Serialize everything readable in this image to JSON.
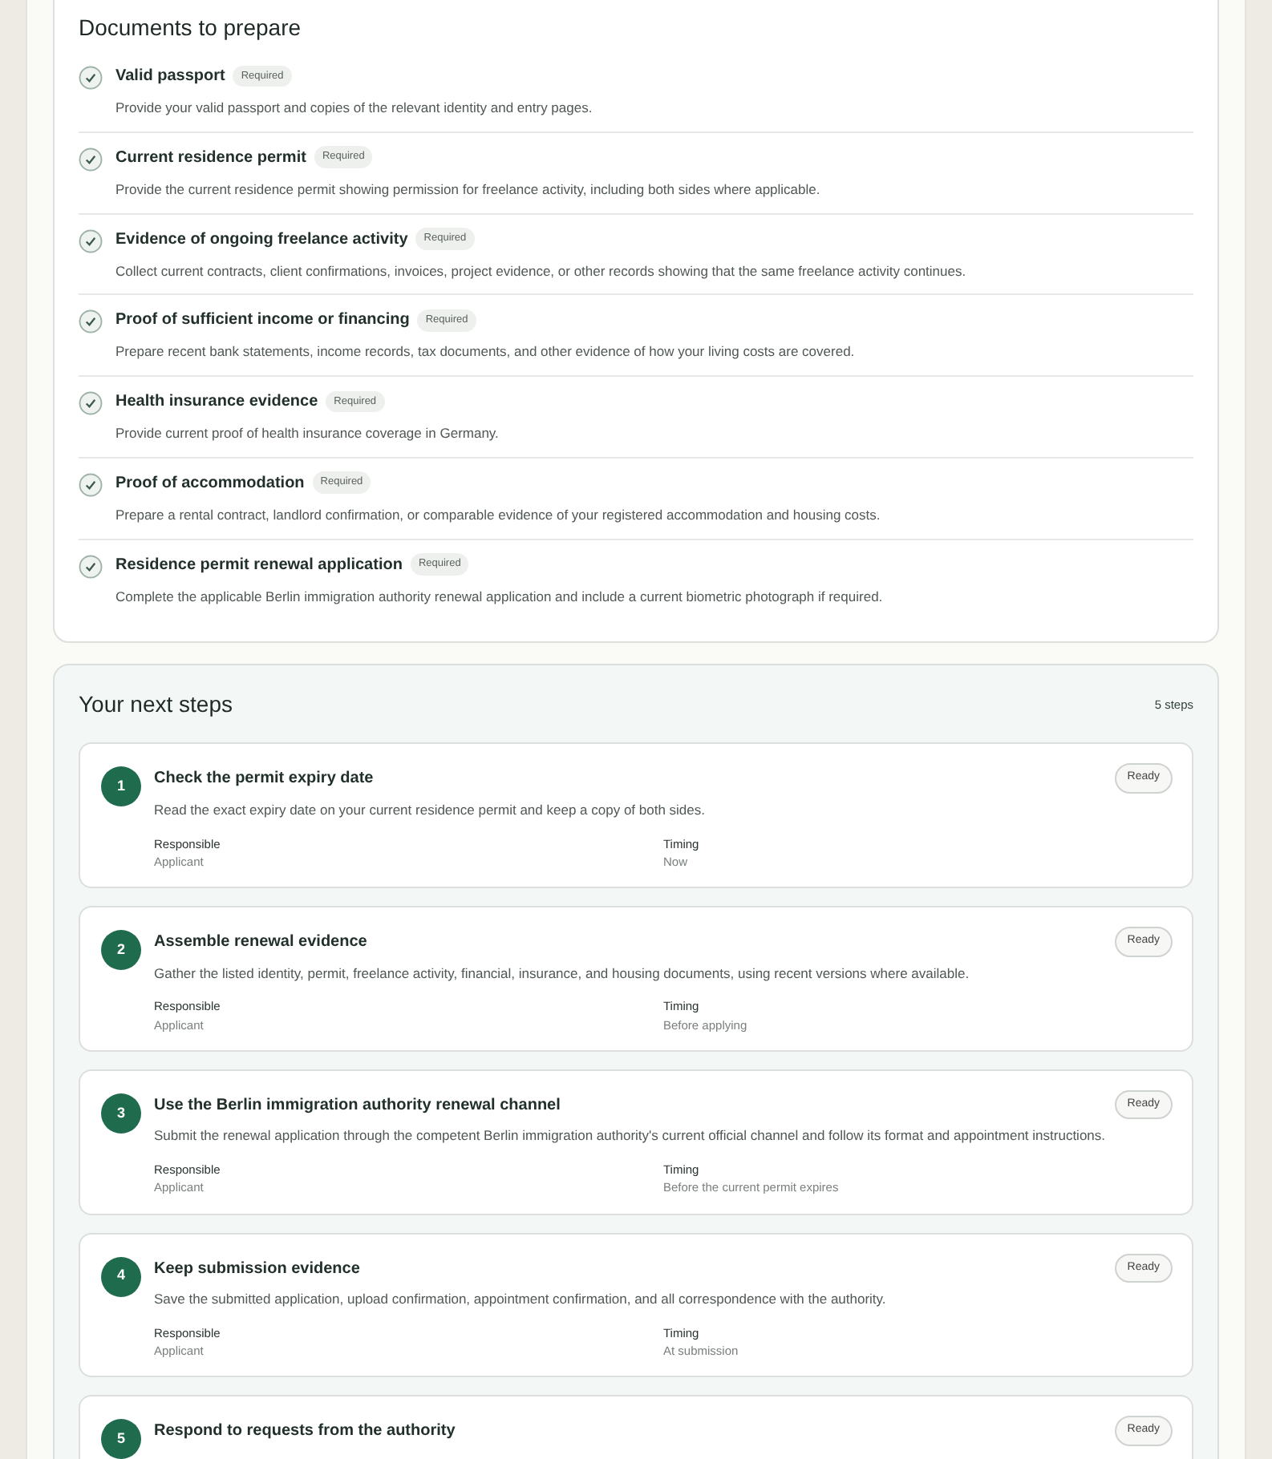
{
  "documents": {
    "title": "Documents to prepare",
    "items": [
      {
        "name": "Valid passport",
        "badge": "Required",
        "checked": true,
        "description": "Provide your valid passport and copies of the relevant identity and entry pages."
      },
      {
        "name": "Current residence permit",
        "badge": "Required",
        "checked": true,
        "description": "Provide the current residence permit showing permission for freelance activity, including both sides where applicable."
      },
      {
        "name": "Evidence of ongoing freelance activity",
        "badge": "Required",
        "checked": true,
        "description": "Collect current contracts, client confirmations, invoices, project evidence, or other records showing that the same freelance activity continues."
      },
      {
        "name": "Proof of sufficient income or financing",
        "badge": "Required",
        "checked": true,
        "description": "Prepare recent bank statements, income records, tax documents, and other evidence of how your living costs are covered."
      },
      {
        "name": "Health insurance evidence",
        "badge": "Required",
        "checked": true,
        "description": "Provide current proof of health insurance coverage in Germany."
      },
      {
        "name": "Proof of accommodation",
        "badge": "Required",
        "checked": true,
        "description": "Prepare a rental contract, landlord confirmation, or comparable evidence of your registered accommodation and housing costs."
      },
      {
        "name": "Residence permit renewal application",
        "badge": "Required",
        "checked": true,
        "description": "Complete the applicable Berlin immigration authority renewal application and include a current biometric photograph if required."
      }
    ]
  },
  "next_steps": {
    "title": "Your next steps",
    "count": "5 steps",
    "steps": [
      {
        "number": "1",
        "title": "Check the permit expiry date",
        "status": "Ready",
        "description": "Read the exact expiry date on your current residence permit and keep a copy of both sides.",
        "responsible_label": "Responsible",
        "responsible": "Applicant",
        "timing_label": "Timing",
        "timing": "Now"
      },
      {
        "number": "2",
        "title": "Assemble renewal evidence",
        "status": "Ready",
        "description": "Gather the listed identity, permit, freelance activity, financial, insurance, and housing documents, using recent versions where available.",
        "responsible_label": "Responsible",
        "responsible": "Applicant",
        "timing_label": "Timing",
        "timing": "Before applying"
      },
      {
        "number": "3",
        "title": "Use the Berlin immigration authority renewal channel",
        "status": "Ready",
        "description": "Submit the renewal application through the competent Berlin immigration authority's current official channel and follow its format and appointment instructions.",
        "responsible_label": "Responsible",
        "responsible": "Applicant",
        "timing_label": "Timing",
        "timing": "Before the current permit expires"
      },
      {
        "number": "4",
        "title": "Keep submission evidence",
        "status": "Ready",
        "description": "Save the submitted application, upload confirmation, appointment confirmation, and all correspondence with the authority.",
        "responsible_label": "Responsible",
        "responsible": "Applicant",
        "timing_label": "Timing",
        "timing": "At submission"
      },
      {
        "number": "5",
        "title": "Respond to requests from the authority",
        "status": "Ready"
      }
    ]
  }
}
